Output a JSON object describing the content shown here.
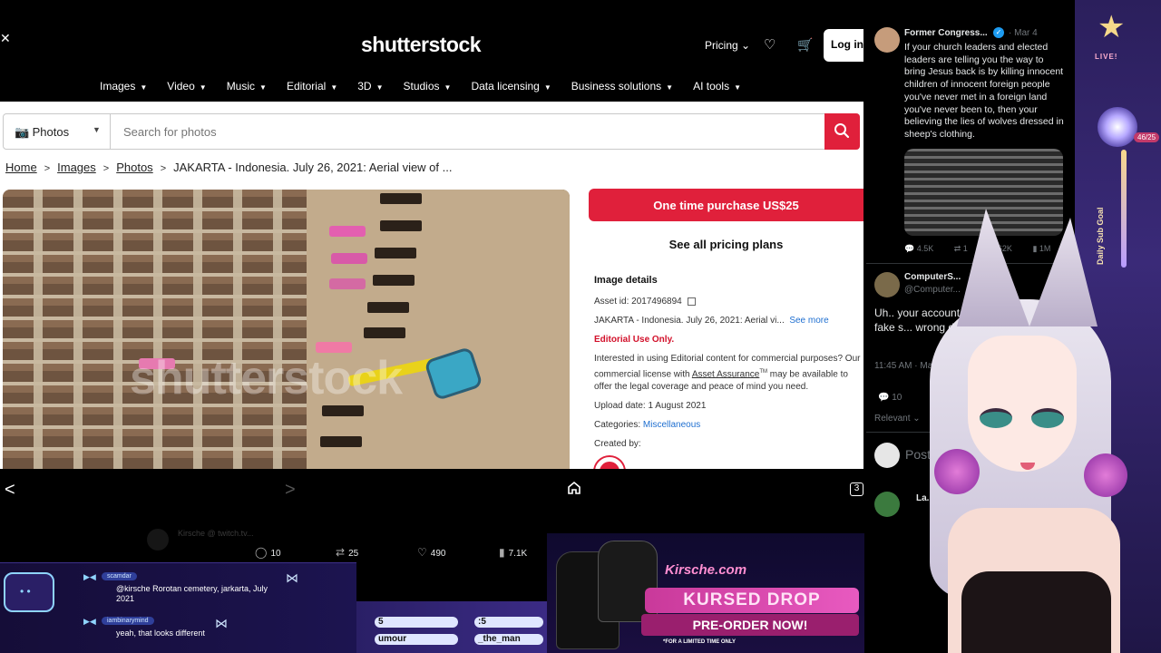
{
  "shutterstock": {
    "close": "✕",
    "logo": "shutterstock",
    "pricing": "Pricing",
    "login": "Log in",
    "nav": [
      "Images",
      "Video",
      "Music",
      "Editorial",
      "3D",
      "Studios",
      "Data licensing",
      "Business solutions",
      "AI tools"
    ],
    "search": {
      "type": "Photos",
      "placeholder": "Search for photos"
    },
    "breadcrumbs": [
      "Home",
      "Images",
      "Photos",
      "JAKARTA - Indonesia. July 26, 2021: Aerial view of ..."
    ],
    "photo_watermark": "shutterstock",
    "buy_button": "One time purchase US$25",
    "see_plans": "See all pricing plans",
    "details": {
      "heading": "Image details",
      "asset_id": "Asset id: 2017496894",
      "description": "JAKARTA - Indonesia. July 26, 2021: Aerial vi...",
      "see_more": "See more",
      "editorial": "Editorial Use Only.",
      "para_a": "Interested in using Editorial content for commercial purposes? Our commercial license with",
      "para_link": "Asset Assurance",
      "para_tm": "TM",
      "para_b": "may be available to offer the legal coverage and peace of mind you need.",
      "upload": "Upload date: 1 August 2021",
      "categories_label": "Categories:",
      "categories_value": "Miscellaneous",
      "created_by": "Created by:"
    },
    "tab_count": "3"
  },
  "twitter": {
    "tweet1": {
      "name": "Former Congress...",
      "time": "· Mar 4",
      "text": "If your church leaders and elected leaders are telling you the way to bring Jesus back is by killing innocent children of innocent foreign people you've never met in a foreign land you've never been to, then your believing the lies of wolves dressed in sheep's clothing.",
      "stats": [
        "4.5K",
        "1",
        "62K",
        "1M"
      ]
    },
    "tweet2": {
      "name": "ComputerS...",
      "handle": "@Computer...",
      "text": "Uh.. your account ... shut down for fake s... wrong date",
      "time": "11:45 AM · Mar 4, 2024",
      "replies": "10",
      "retweets": "25",
      "relevant": "Relevant"
    },
    "post_placeholder": "Post y...",
    "reply_name": "La..."
  },
  "bottom_stats": {
    "replies": "10",
    "retweets": "25",
    "likes": "490",
    "views": "7.1K"
  },
  "ghost_text": "Kirsche @ twitch.tv...",
  "chat": [
    {
      "user": "scamdar",
      "msg": "@kirsche Rorotan cemetery, jarkarta, July 2021"
    },
    {
      "user": "iambinarymind",
      "msg": "yeah, that looks different"
    }
  ],
  "stream_bar": {
    "left_a": "5",
    "left_b": "umour",
    "right_a": ":5",
    "right_b": "_the_man"
  },
  "merch": {
    "brand": "Kirsche.com",
    "title": "KURSED DROP",
    "preorder": "PRE-ORDER NOW!",
    "limited": "*FOR A LIMITED TIME ONLY"
  },
  "deco": {
    "live": "LIVE!",
    "goal_count": "46/25",
    "goal_label": "Daily Sub Goal"
  },
  "colors": {
    "shutterstock_red": "#e0203b",
    "twitter_blue": "#1d9bf0",
    "stream_purple": "#2b1f5c"
  }
}
